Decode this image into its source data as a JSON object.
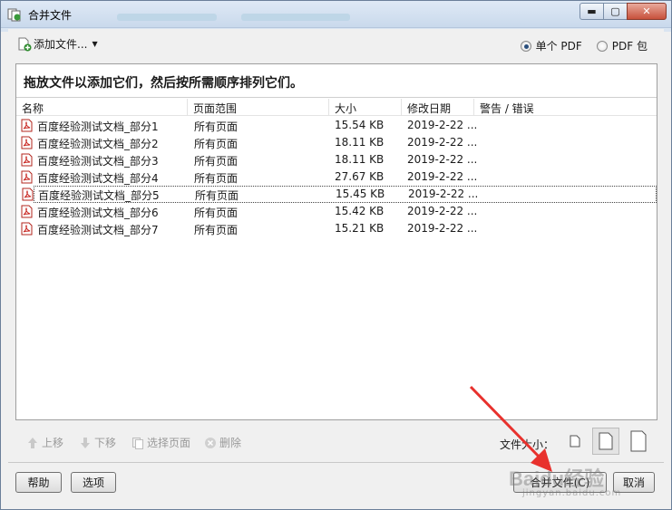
{
  "window": {
    "title": "合并文件",
    "minimize_glyph": "▬",
    "maximize_glyph": "▢",
    "close_glyph": "✕"
  },
  "toolbar": {
    "add_files_label": "添加文件...",
    "output_options": [
      {
        "label": "单个 PDF",
        "selected": true
      },
      {
        "label": "PDF 包",
        "selected": false
      }
    ]
  },
  "panel": {
    "instruction": "拖放文件以添加它们，然后按所需顺序排列它们。",
    "columns": [
      "名称",
      "页面范围",
      "大小",
      "修改日期",
      "警告 / 错误"
    ],
    "rows": [
      {
        "name": "百度经验测试文档_部分1",
        "range": "所有页面",
        "size": "15.54 KB",
        "date": "2019-2-22 ...",
        "warning": ""
      },
      {
        "name": "百度经验测试文档_部分2",
        "range": "所有页面",
        "size": "18.11 KB",
        "date": "2019-2-22 ...",
        "warning": ""
      },
      {
        "name": "百度经验测试文档_部分3",
        "range": "所有页面",
        "size": "18.11 KB",
        "date": "2019-2-22 ...",
        "warning": ""
      },
      {
        "name": "百度经验测试文档_部分4",
        "range": "所有页面",
        "size": "27.67 KB",
        "date": "2019-2-22 ...",
        "warning": ""
      },
      {
        "name": "百度经验测试文档_部分5",
        "range": "所有页面",
        "size": "15.45 KB",
        "date": "2019-2-22 ...",
        "warning": "",
        "selected": true
      },
      {
        "name": "百度经验测试文档_部分6",
        "range": "所有页面",
        "size": "15.42 KB",
        "date": "2019-2-22 ...",
        "warning": ""
      },
      {
        "name": "百度经验测试文档_部分7",
        "range": "所有页面",
        "size": "15.21 KB",
        "date": "2019-2-22 ...",
        "warning": ""
      }
    ]
  },
  "bottom_tools": {
    "move_up": "上移",
    "move_down": "下移",
    "choose_pages": "选择页面",
    "delete": "删除",
    "file_size_label": "文件大小："
  },
  "footer": {
    "help": "帮助",
    "options": "选项",
    "merge": "合并文件(C)",
    "cancel": "取消"
  },
  "watermark": {
    "text": "Baidu经验",
    "sub": "jingyan.baidu.com"
  },
  "colors": {
    "pdf_red": "#c8231e",
    "arrow_red": "#e8312d"
  }
}
